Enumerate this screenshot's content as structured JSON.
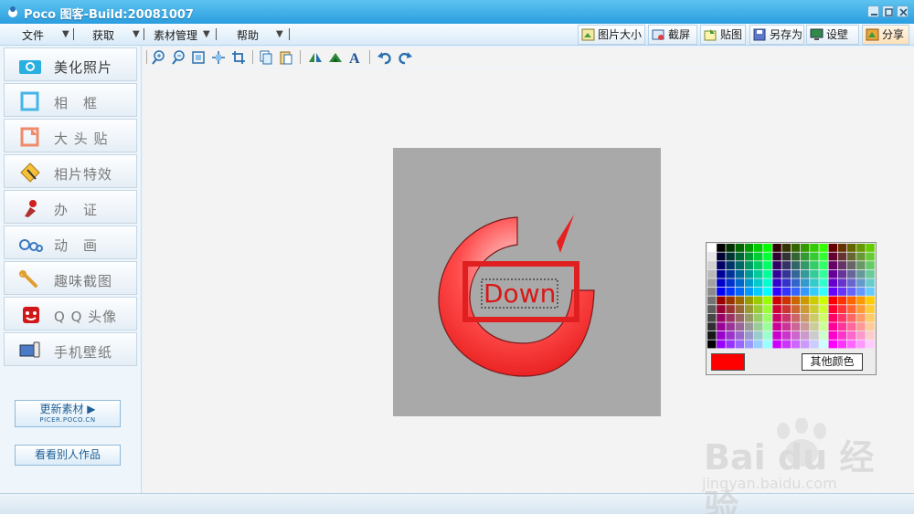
{
  "window": {
    "title": "Poco 图客-Build:20081007"
  },
  "menu": {
    "items": [
      {
        "label": "文件"
      },
      {
        "label": "获取"
      },
      {
        "label": "素材管理"
      },
      {
        "label": "帮助"
      }
    ]
  },
  "right_toolbar": {
    "items": [
      {
        "label": "图片大小",
        "icon": "resize-icon"
      },
      {
        "label": "截屏",
        "icon": "screenshot-icon"
      },
      {
        "label": "贴图",
        "icon": "paste-image-icon"
      },
      {
        "label": "另存为",
        "icon": "save-as-icon"
      },
      {
        "label": "设壁纸",
        "icon": "wallpaper-icon"
      },
      {
        "label": "分享",
        "icon": "share-icon"
      }
    ]
  },
  "sidebar": {
    "items": [
      {
        "label": "美化照片",
        "icon": "camera-icon"
      },
      {
        "label": "相　框",
        "icon": "frame-icon"
      },
      {
        "label": "大 头 贴",
        "icon": "sticker-icon"
      },
      {
        "label": "相片特效",
        "icon": "effects-icon"
      },
      {
        "label": "办　证",
        "icon": "stamp-icon"
      },
      {
        "label": "动　画",
        "icon": "gears-icon"
      },
      {
        "label": "趣味截图",
        "icon": "wrench-icon"
      },
      {
        "label": "Q Q 头像",
        "icon": "qq-face-icon"
      },
      {
        "label": "手机壁纸",
        "icon": "phone-icon"
      }
    ],
    "update_button": {
      "label": "更新素材",
      "sub": "PICER.POCO.CN"
    },
    "gallery_button": {
      "label": "看看别人作品"
    }
  },
  "canvas": {
    "text_overlay": "Down"
  },
  "palette": {
    "selected_color": "#ff0000",
    "other_colors_label": "其他颜色"
  },
  "watermark": {
    "brand": "Bai du 经验",
    "url": "jingyan.baidu.com"
  }
}
